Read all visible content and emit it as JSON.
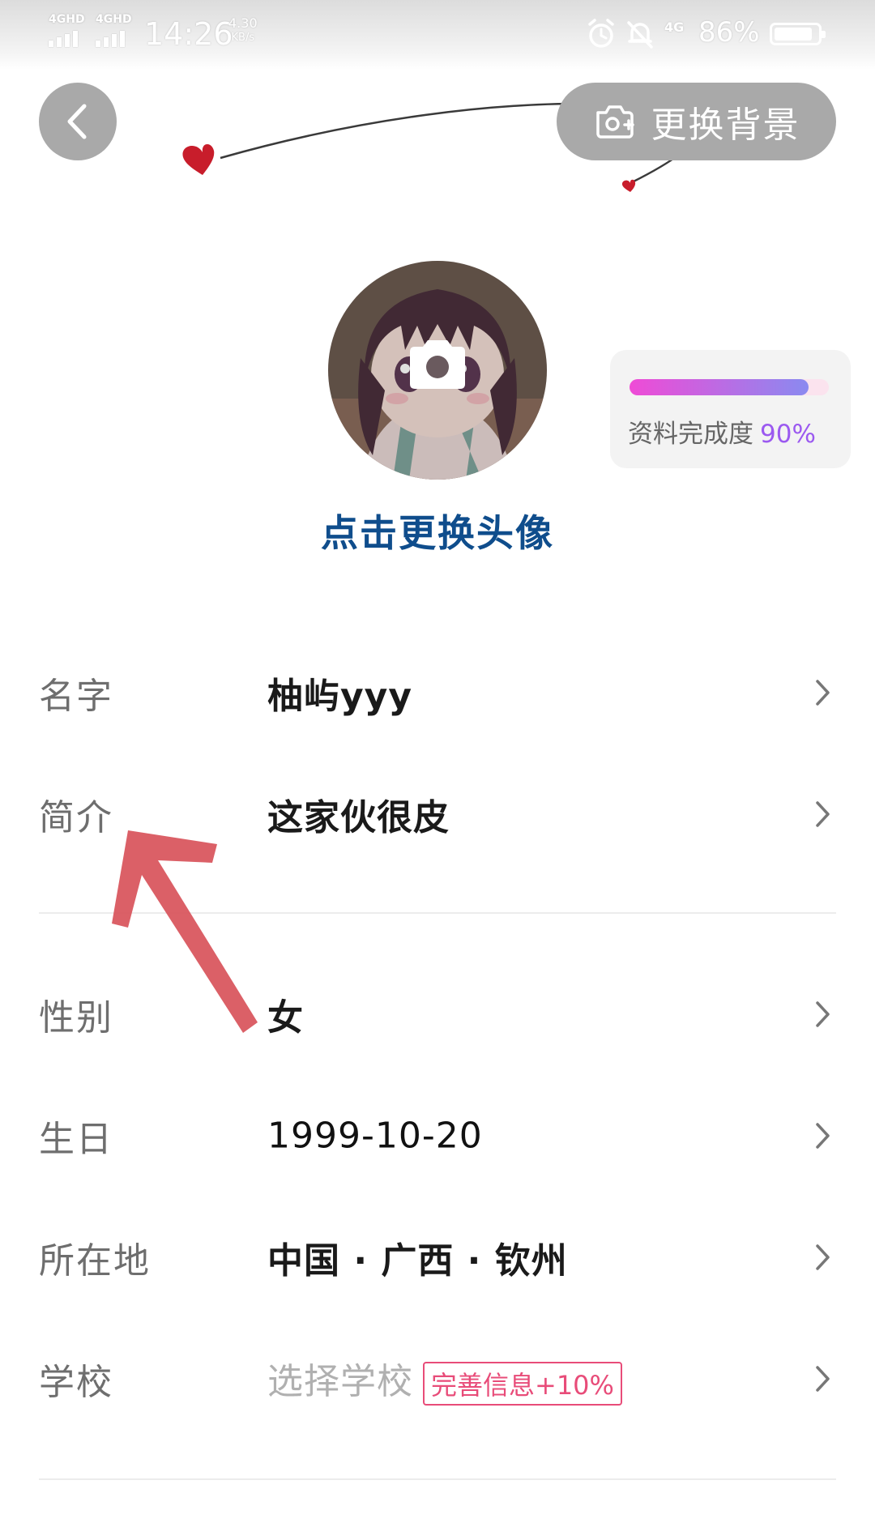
{
  "status_bar": {
    "network1": "4GHD",
    "network2": "4GHD",
    "time": "14:26",
    "speed_value": "4.30",
    "speed_unit": "KB/s",
    "network3": "4G",
    "battery": "86%"
  },
  "header": {
    "change_background_label": "更换背景"
  },
  "avatar": {
    "change_label": "点击更换头像"
  },
  "completeness": {
    "label": "资料完成度",
    "percent_text": "90%",
    "percent_value": 0.9
  },
  "profile_rows": [
    {
      "label": "名字",
      "value": "柚屿yyy"
    },
    {
      "label": "简介",
      "value": "这家伙很皮"
    },
    {
      "label": "性别",
      "value": "女"
    },
    {
      "label": "生日",
      "value": "1999-10-20"
    },
    {
      "label": "所在地",
      "value": "中国 · 广西 · 钦州"
    },
    {
      "label": "学校",
      "value": "选择学校",
      "badge": "完善信息+10%"
    }
  ],
  "colors": {
    "accent_blue": "#0f4d8c",
    "badge_red": "#e84c79",
    "progress_start": "#ef4bd6",
    "progress_end": "#8a8af0"
  }
}
